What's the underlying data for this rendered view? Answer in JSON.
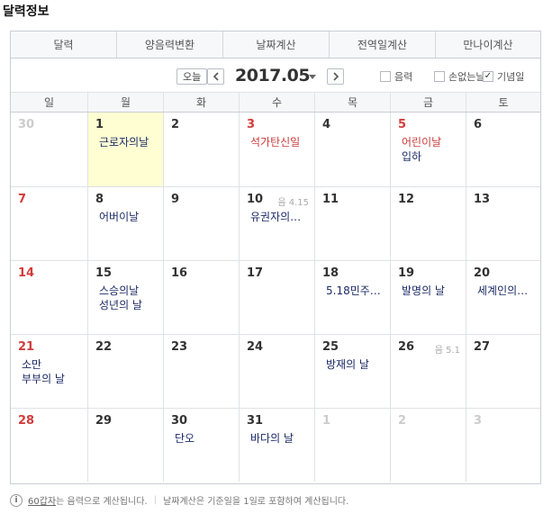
{
  "title": "달력정보",
  "tabs": [
    {
      "label": "달력",
      "active": true
    },
    {
      "label": "양음력변환",
      "active": false
    },
    {
      "label": "날짜계산",
      "active": false
    },
    {
      "label": "전역일계산",
      "active": false
    },
    {
      "label": "만나이계산",
      "active": false
    }
  ],
  "toolbar": {
    "today_label": "오늘",
    "year_month": "2017.05",
    "options": [
      {
        "label": "음력",
        "checked": false
      },
      {
        "label": "손없는날",
        "checked": false
      },
      {
        "label": "기념일",
        "checked": true
      }
    ]
  },
  "weekdays": [
    "일",
    "월",
    "화",
    "수",
    "목",
    "금",
    "토"
  ],
  "weeks": [
    [
      {
        "day": "30",
        "other": true,
        "events": []
      },
      {
        "day": "1",
        "today": true,
        "events": [
          {
            "text": "근로자의날"
          }
        ]
      },
      {
        "day": "2",
        "events": []
      },
      {
        "day": "3",
        "sun": true,
        "events": [
          {
            "text": "석가탄신일",
            "holiday": true
          }
        ]
      },
      {
        "day": "4",
        "events": []
      },
      {
        "day": "5",
        "sun": true,
        "events": [
          {
            "text": "어린이날",
            "holiday": true
          },
          {
            "text": "입하"
          }
        ]
      },
      {
        "day": "6",
        "events": []
      }
    ],
    [
      {
        "day": "7",
        "sun": true,
        "events": []
      },
      {
        "day": "8",
        "events": [
          {
            "text": "어버이날"
          }
        ]
      },
      {
        "day": "9",
        "events": []
      },
      {
        "day": "10",
        "lunar": "음 4.15",
        "events": [
          {
            "text": "유권자의…"
          }
        ]
      },
      {
        "day": "11",
        "events": []
      },
      {
        "day": "12",
        "events": []
      },
      {
        "day": "13",
        "events": []
      }
    ],
    [
      {
        "day": "14",
        "sun": true,
        "events": []
      },
      {
        "day": "15",
        "events": [
          {
            "text": "스승의날"
          },
          {
            "text": "성년의 날"
          }
        ]
      },
      {
        "day": "16",
        "events": []
      },
      {
        "day": "17",
        "events": []
      },
      {
        "day": "18",
        "events": [
          {
            "text": "5.18민주…"
          }
        ]
      },
      {
        "day": "19",
        "events": [
          {
            "text": "발명의 날"
          }
        ]
      },
      {
        "day": "20",
        "events": [
          {
            "text": "세계인의…"
          }
        ]
      }
    ],
    [
      {
        "day": "21",
        "sun": true,
        "events": [
          {
            "text": "소만"
          },
          {
            "text": "부부의 날"
          }
        ]
      },
      {
        "day": "22",
        "events": []
      },
      {
        "day": "23",
        "events": []
      },
      {
        "day": "24",
        "events": []
      },
      {
        "day": "25",
        "events": [
          {
            "text": "방재의 날"
          }
        ]
      },
      {
        "day": "26",
        "lunar": "음 5.1",
        "events": []
      },
      {
        "day": "27",
        "events": []
      }
    ],
    [
      {
        "day": "28",
        "sun": true,
        "events": []
      },
      {
        "day": "29",
        "events": []
      },
      {
        "day": "30",
        "events": [
          {
            "text": "단오"
          }
        ]
      },
      {
        "day": "31",
        "events": [
          {
            "text": "바다의 날"
          }
        ]
      },
      {
        "day": "1",
        "other": true,
        "events": []
      },
      {
        "day": "2",
        "other": true,
        "events": []
      },
      {
        "day": "3",
        "other": true,
        "events": []
      }
    ]
  ],
  "footer": {
    "icon": "info-icon",
    "link": "60갑자",
    "text1": "는 음력으로 계산됩니다.",
    "sep": "|",
    "text2": "날짜계산은 기준일을 1일로 포함하여 계산됩니다."
  }
}
